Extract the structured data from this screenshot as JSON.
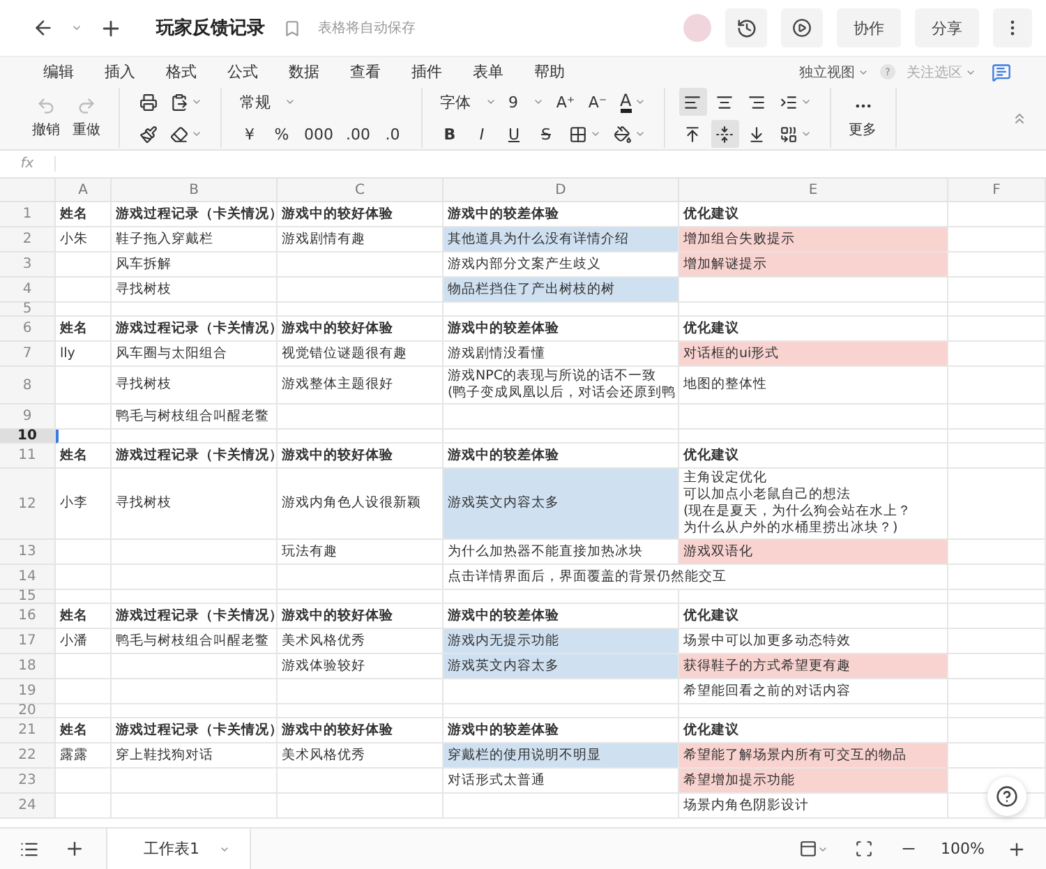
{
  "titlebar": {
    "title": "玩家反馈记录",
    "save_status": "表格将自动保存",
    "buttons": [
      "协作",
      "分享"
    ]
  },
  "menu": {
    "items": [
      "编辑",
      "插入",
      "格式",
      "公式",
      "数据",
      "查看",
      "插件",
      "表单",
      "帮助"
    ],
    "view": "独立视图",
    "help": "?",
    "focus": "关注选区"
  },
  "toolbar": {
    "groups": [
      {
        "top": [
          {
            "kind": "undo",
            "label": "撤销",
            "disabled": true
          },
          {
            "kind": "redo",
            "label": "重做",
            "disabled": true
          }
        ]
      },
      {
        "top": [
          {
            "kind": "print"
          },
          {
            "kind": "paste"
          }
        ],
        "bottom": [
          {
            "kind": "painter"
          },
          {
            "kind": "eraser"
          }
        ]
      },
      {
        "top": [
          {
            "kind": "dropdown",
            "label": "常规"
          }
        ],
        "bottom": [
          {
            "kind": "text",
            "label": "¥"
          },
          {
            "kind": "text",
            "label": "%"
          },
          {
            "kind": "text",
            "label": "000"
          },
          {
            "kind": "text",
            "label": ".00"
          },
          {
            "kind": "text",
            "label": ".0"
          }
        ]
      },
      {
        "top": [
          {
            "kind": "dropdown",
            "label": "字体"
          },
          {
            "kind": "dropdown",
            "label": "9"
          },
          {
            "kind": "text",
            "label": "A⁺"
          },
          {
            "kind": "text",
            "label": "A⁻"
          },
          {
            "kind": "fontcolor",
            "label": "A"
          }
        ],
        "bottom": [
          {
            "kind": "bold",
            "label": "B"
          },
          {
            "kind": "italic",
            "label": "I"
          },
          {
            "kind": "underline",
            "label": "U"
          },
          {
            "kind": "strike",
            "label": "S"
          },
          {
            "kind": "borders"
          },
          {
            "kind": "fill"
          }
        ]
      },
      {
        "top": [
          {
            "kind": "alignleft",
            "selected": true
          },
          {
            "kind": "aligncenter",
            "selected": false
          },
          {
            "kind": "alignright",
            "selected": false
          },
          {
            "kind": "indent"
          }
        ],
        "bottom": [
          {
            "kind": "valigntop",
            "selected": false
          },
          {
            "kind": "valignmiddle",
            "selected": true
          },
          {
            "kind": "valignbottom",
            "selected": false
          },
          {
            "kind": "merge"
          }
        ]
      },
      {
        "top": [
          {
            "kind": "more",
            "label": "更多"
          }
        ]
      }
    ]
  },
  "formula_bar": {
    "label": "fx"
  },
  "sheet": {
    "columns": [
      "A",
      "B",
      "C",
      "D",
      "E",
      "F"
    ],
    "rows": [
      {
        "number": "1",
        "kind": "header",
        "selected": false,
        "cells": {
          "A": {
            "lines": [
              "姓名"
            ]
          },
          "B": {
            "lines": [
              "游戏过程记录（卡关情况）"
            ]
          },
          "C": {
            "lines": [
              "游戏中的较好体验"
            ]
          },
          "D": {
            "lines": [
              "游戏中的较差体验"
            ]
          },
          "E": {
            "lines": [
              "优化建议"
            ]
          }
        }
      },
      {
        "number": "2",
        "kind": "data",
        "selected": false,
        "cells": {
          "A": {
            "lines": [
              "小朱"
            ]
          },
          "B": {
            "lines": [
              "鞋子拖入穿戴栏"
            ]
          },
          "C": {
            "lines": [
              "游戏剧情有趣"
            ]
          },
          "D": {
            "lines": [
              "其他道具为什么没有详情介绍"
            ],
            "color": "#cfe0f1"
          },
          "E": {
            "lines": [
              "增加组合失败提示"
            ],
            "color": "#f9d3d0"
          }
        }
      },
      {
        "number": "3",
        "kind": "data",
        "selected": false,
        "cells": {
          "B": {
            "lines": [
              "风车拆解"
            ]
          },
          "D": {
            "lines": [
              "游戏内部分文案产生歧义"
            ]
          },
          "E": {
            "lines": [
              "增加解谜提示"
            ],
            "color": "#f9d3d0"
          }
        }
      },
      {
        "number": "4",
        "kind": "data",
        "selected": false,
        "cells": {
          "B": {
            "lines": [
              "寻找树枝"
            ]
          },
          "D": {
            "lines": [
              "物品栏挡住了产出树枝的树"
            ],
            "color": "#cfe0f1"
          }
        }
      },
      {
        "number": "5",
        "kind": "gap",
        "selected": false,
        "cells": {}
      },
      {
        "number": "6",
        "kind": "header",
        "selected": false,
        "cells": {
          "A": {
            "lines": [
              "姓名"
            ]
          },
          "B": {
            "lines": [
              "游戏过程记录（卡关情况）"
            ]
          },
          "C": {
            "lines": [
              "游戏中的较好体验"
            ]
          },
          "D": {
            "lines": [
              "游戏中的较差体验"
            ]
          },
          "E": {
            "lines": [
              "优化建议"
            ]
          }
        }
      },
      {
        "number": "7",
        "kind": "data",
        "selected": false,
        "cells": {
          "A": {
            "lines": [
              "lly"
            ]
          },
          "B": {
            "lines": [
              "风车圈与太阳组合"
            ]
          },
          "C": {
            "lines": [
              "视觉错位谜题很有趣"
            ]
          },
          "D": {
            "lines": [
              "游戏剧情没看懂"
            ]
          },
          "E": {
            "lines": [
              "对话框的ui形式"
            ],
            "color": "#f9d3d0"
          }
        }
      },
      {
        "number": "8",
        "kind": "data",
        "selected": false,
        "cells": {
          "B": {
            "lines": [
              "寻找树枝"
            ]
          },
          "C": {
            "lines": [
              "游戏整体主题很好"
            ]
          },
          "D": {
            "lines": [
              "游戏NPC的表现与所说的话不一致",
              "(鸭子变成凤凰以后，对话会还原到鸭"
            ]
          },
          "E": {
            "lines": [
              "地图的整体性"
            ]
          }
        }
      },
      {
        "number": "9",
        "kind": "data",
        "selected": false,
        "cells": {
          "B": {
            "lines": [
              "鸭毛与树枝组合叫醒老鳖"
            ]
          }
        }
      },
      {
        "number": "10",
        "kind": "gap",
        "selected": true,
        "cells": {}
      },
      {
        "number": "11",
        "kind": "header",
        "selected": false,
        "cells": {
          "A": {
            "lines": [
              "姓名"
            ]
          },
          "B": {
            "lines": [
              "游戏过程记录（卡关情况）"
            ]
          },
          "C": {
            "lines": [
              "游戏中的较好体验"
            ]
          },
          "D": {
            "lines": [
              "游戏中的较差体验"
            ]
          },
          "E": {
            "lines": [
              "优化建议"
            ]
          }
        }
      },
      {
        "number": "12",
        "kind": "data",
        "selected": false,
        "cells": {
          "A": {
            "lines": [
              "小李"
            ]
          },
          "B": {
            "lines": [
              "寻找树枝"
            ]
          },
          "C": {
            "lines": [
              "游戏内角色人设很新颖"
            ]
          },
          "D": {
            "lines": [
              "游戏英文内容太多"
            ],
            "color": "#cfe0f1"
          },
          "E": {
            "lines": [
              "主角设定优化",
              "可以加点小老鼠自己的想法",
              "(现在是夏天，为什么狗会站在水上？",
              "为什么从户外的水桶里捞出冰块？)"
            ]
          }
        }
      },
      {
        "number": "13",
        "kind": "data",
        "selected": false,
        "cells": {
          "C": {
            "lines": [
              "玩法有趣"
            ]
          },
          "D": {
            "lines": [
              "为什么加热器不能直接加热冰块"
            ]
          },
          "E": {
            "lines": [
              "游戏双语化"
            ],
            "color": "#f9d3d0"
          }
        }
      },
      {
        "number": "14",
        "kind": "data",
        "selected": false,
        "cells": {
          "D": {
            "lines": [
              "点击详情界面后，界面覆盖的背景仍然能交互"
            ]
          }
        }
      },
      {
        "number": "15",
        "kind": "gap",
        "selected": false,
        "cells": {}
      },
      {
        "number": "16",
        "kind": "header",
        "selected": false,
        "cells": {
          "A": {
            "lines": [
              "姓名"
            ]
          },
          "B": {
            "lines": [
              "游戏过程记录（卡关情况）"
            ]
          },
          "C": {
            "lines": [
              "游戏中的较好体验"
            ]
          },
          "D": {
            "lines": [
              "游戏中的较差体验"
            ]
          },
          "E": {
            "lines": [
              "优化建议"
            ]
          }
        }
      },
      {
        "number": "17",
        "kind": "data",
        "selected": false,
        "cells": {
          "A": {
            "lines": [
              "小潘"
            ]
          },
          "B": {
            "lines": [
              "鸭毛与树枝组合叫醒老鳖"
            ]
          },
          "C": {
            "lines": [
              "美术风格优秀"
            ]
          },
          "D": {
            "lines": [
              "游戏内无提示功能"
            ],
            "color": "#cfe0f1"
          },
          "E": {
            "lines": [
              "场景中可以加更多动态特效"
            ]
          }
        }
      },
      {
        "number": "18",
        "kind": "data",
        "selected": false,
        "cells": {
          "C": {
            "lines": [
              "游戏体验较好"
            ]
          },
          "D": {
            "lines": [
              "游戏英文内容太多"
            ],
            "color": "#cfe0f1"
          },
          "E": {
            "lines": [
              "获得鞋子的方式希望更有趣"
            ],
            "color": "#f9d3d0"
          }
        }
      },
      {
        "number": "19",
        "kind": "data",
        "selected": false,
        "cells": {
          "E": {
            "lines": [
              "希望能回看之前的对话内容"
            ]
          }
        }
      },
      {
        "number": "20",
        "kind": "gap",
        "selected": false,
        "cells": {}
      },
      {
        "number": "21",
        "kind": "header",
        "selected": false,
        "cells": {
          "A": {
            "lines": [
              "姓名"
            ]
          },
          "B": {
            "lines": [
              "游戏过程记录（卡关情况）"
            ]
          },
          "C": {
            "lines": [
              "游戏中的较好体验"
            ]
          },
          "D": {
            "lines": [
              "游戏中的较差体验"
            ]
          },
          "E": {
            "lines": [
              "优化建议"
            ]
          }
        }
      },
      {
        "number": "22",
        "kind": "data",
        "selected": false,
        "cells": {
          "A": {
            "lines": [
              "露露"
            ]
          },
          "B": {
            "lines": [
              "穿上鞋找狗对话"
            ]
          },
          "C": {
            "lines": [
              "美术风格优秀"
            ]
          },
          "D": {
            "lines": [
              "穿戴栏的使用说明不明显"
            ],
            "color": "#cfe0f1"
          },
          "E": {
            "lines": [
              "希望能了解场景内所有可交互的物品"
            ],
            "color": "#f9d3d0"
          }
        }
      },
      {
        "number": "23",
        "kind": "data",
        "selected": false,
        "cells": {
          "D": {
            "lines": [
              "对话形式太普通"
            ]
          },
          "E": {
            "lines": [
              "希望增加提示功能"
            ],
            "color": "#f9d3d0"
          }
        }
      },
      {
        "number": "24",
        "kind": "data",
        "selected": false,
        "cells": {
          "E": {
            "lines": [
              "场景内角色阴影设计"
            ]
          }
        }
      }
    ]
  },
  "bottom_bar": {
    "sheet_tab": {
      "label": "工作表1",
      "selected": true
    },
    "zoom": "100%"
  }
}
